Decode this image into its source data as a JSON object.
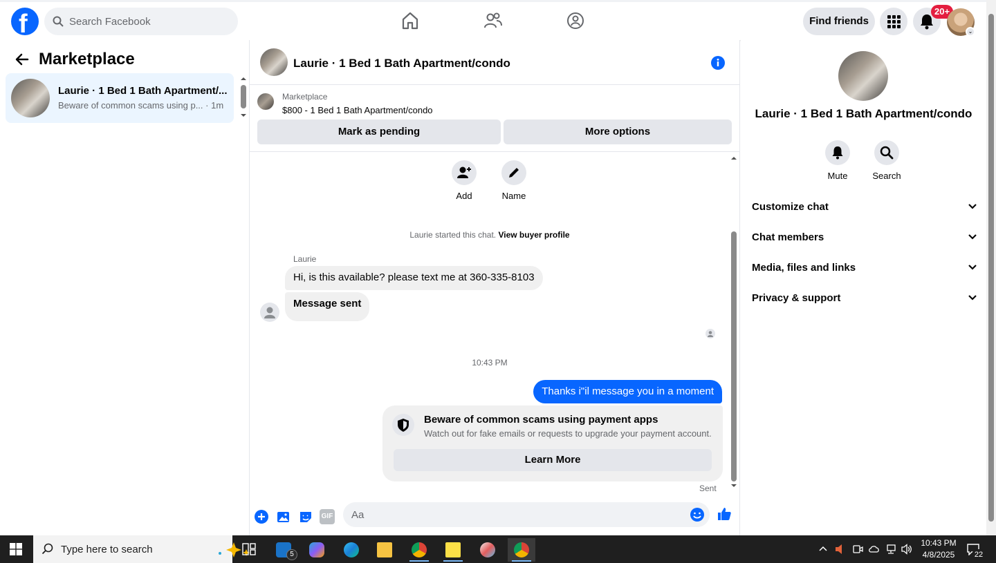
{
  "topbar": {
    "search_placeholder": "Search Facebook",
    "find_friends": "Find friends",
    "notification_count": "20+"
  },
  "left": {
    "title": "Marketplace",
    "conversation": {
      "name": "Laurie · 1 Bed 1 Bath Apartment/...",
      "preview": "Beware of common scams using p... · 1m"
    }
  },
  "chat": {
    "title": "Laurie · 1 Bed 1 Bath Apartment/condo",
    "listing_label": "Marketplace",
    "listing_price": "$800 - 1 Bed 1 Bath Apartment/condo",
    "mark_pending": "Mark as pending",
    "more_options": "More options",
    "actions": {
      "add": "Add",
      "name": "Name"
    },
    "started_text": "Laurie started this chat.",
    "buyer_profile": "View buyer profile",
    "sender": "Laurie",
    "message1": "Hi, is this available? please text me at 360-335-8103",
    "message2": "Message sent",
    "timestamp": "10:43 PM",
    "outgoing": "Thanks i\"il message you in a moment",
    "scam_title": "Beware of common scams using payment apps",
    "scam_text": "Watch out for fake emails or requests to upgrade your payment account.",
    "learn_more": "Learn More",
    "sent": "Sent",
    "composer_placeholder": "Aa",
    "gif": "GIF"
  },
  "right": {
    "title": "Laurie · 1 Bed 1 Bath Apartment/condo",
    "mute": "Mute",
    "search": "Search",
    "rows": [
      "Customize chat",
      "Chat members",
      "Media, files and links",
      "Privacy & support"
    ]
  },
  "taskbar": {
    "search_placeholder": "Type here to search",
    "task_badge": "5",
    "time": "10:43 PM",
    "date": "4/8/2025",
    "notif_count": "22"
  },
  "colors": {
    "brand_blue": "#0866ff",
    "badge_red": "#e41e3f",
    "bubble_gray": "#f0f0f0"
  }
}
